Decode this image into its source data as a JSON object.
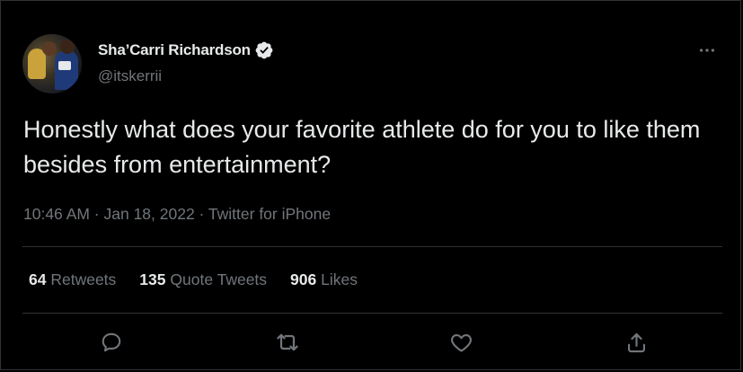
{
  "colors": {
    "background": "#000000",
    "text_primary": "#e7e9ea",
    "text_secondary": "#71767b",
    "divider": "#2f3336",
    "verified_badge": "#e7e9ea"
  },
  "tweet": {
    "author": {
      "display_name": "Sha’Carri Richardson",
      "handle": "@itskerrii",
      "verified_icon": "verified-badge-icon",
      "avatar": "profile-photo"
    },
    "text": "Honestly what does your favorite athlete do for you to like them besides from entertainment?",
    "meta": "10:46 AM · Jan 18, 2022 · Twitter for iPhone",
    "stats": {
      "retweets": {
        "count": "64",
        "label": "Retweets"
      },
      "quote_tweets": {
        "count": "135",
        "label": "Quote Tweets"
      },
      "likes": {
        "count": "906",
        "label": "Likes"
      }
    },
    "actions": [
      {
        "name": "reply",
        "icon": "reply-icon"
      },
      {
        "name": "retweet",
        "icon": "retweet-icon"
      },
      {
        "name": "like",
        "icon": "heart-icon"
      },
      {
        "name": "share",
        "icon": "share-icon"
      }
    ],
    "more_icon": "more-options-icon"
  }
}
